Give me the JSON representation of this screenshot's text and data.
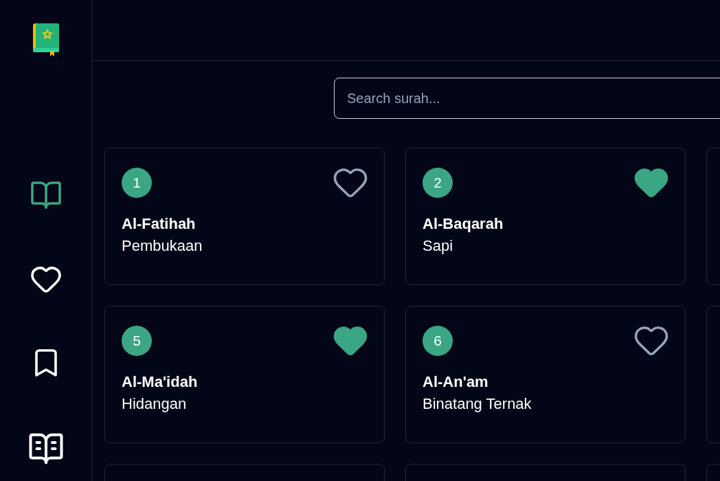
{
  "sidebar": {
    "items": [
      {
        "kind": "read",
        "selected": true
      },
      {
        "kind": "favorites",
        "selected": false
      },
      {
        "kind": "bookmarks",
        "selected": false
      },
      {
        "kind": "tafsir",
        "selected": false
      }
    ]
  },
  "search": {
    "placeholder": "Search surah..."
  },
  "surahs": [
    {
      "number": "1",
      "name": "Al-Fatihah",
      "meaning": "Pembukaan",
      "favorite": false
    },
    {
      "number": "2",
      "name": "Al-Baqarah",
      "meaning": "Sapi",
      "favorite": true
    },
    {
      "number": "5",
      "name": "Al-Ma'idah",
      "meaning": "Hidangan",
      "favorite": true
    },
    {
      "number": "6",
      "name": "Al-An'am",
      "meaning": "Binatang Ternak",
      "favorite": false
    }
  ]
}
